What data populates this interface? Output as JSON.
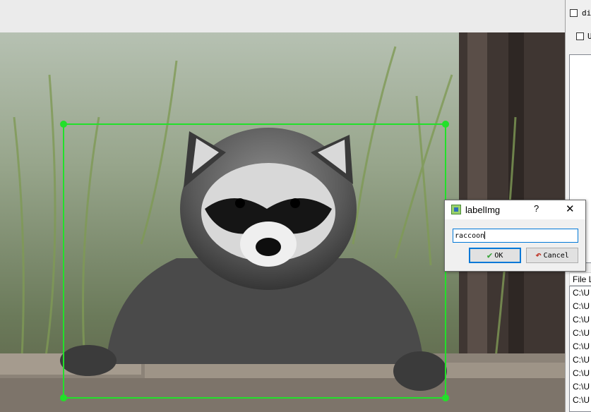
{
  "dialog": {
    "title": "labelImg",
    "help_icon": "?",
    "close_icon": "✕",
    "label_value": "raccoon",
    "ok_label": "OK",
    "cancel_label": "Cancel",
    "app_icon": "labelimg-app-icon"
  },
  "dock": {
    "difficult_label": "di",
    "use_default_label": "U",
    "file_list_header": "File L",
    "files": [
      "C:\\U",
      "C:\\U",
      "C:\\U",
      "C:\\U",
      "C:\\U",
      "C:\\U",
      "C:\\U",
      "C:\\U",
      "C:\\U"
    ]
  },
  "canvas": {
    "box_color": "#22e02a",
    "box_label": "raccoon"
  }
}
